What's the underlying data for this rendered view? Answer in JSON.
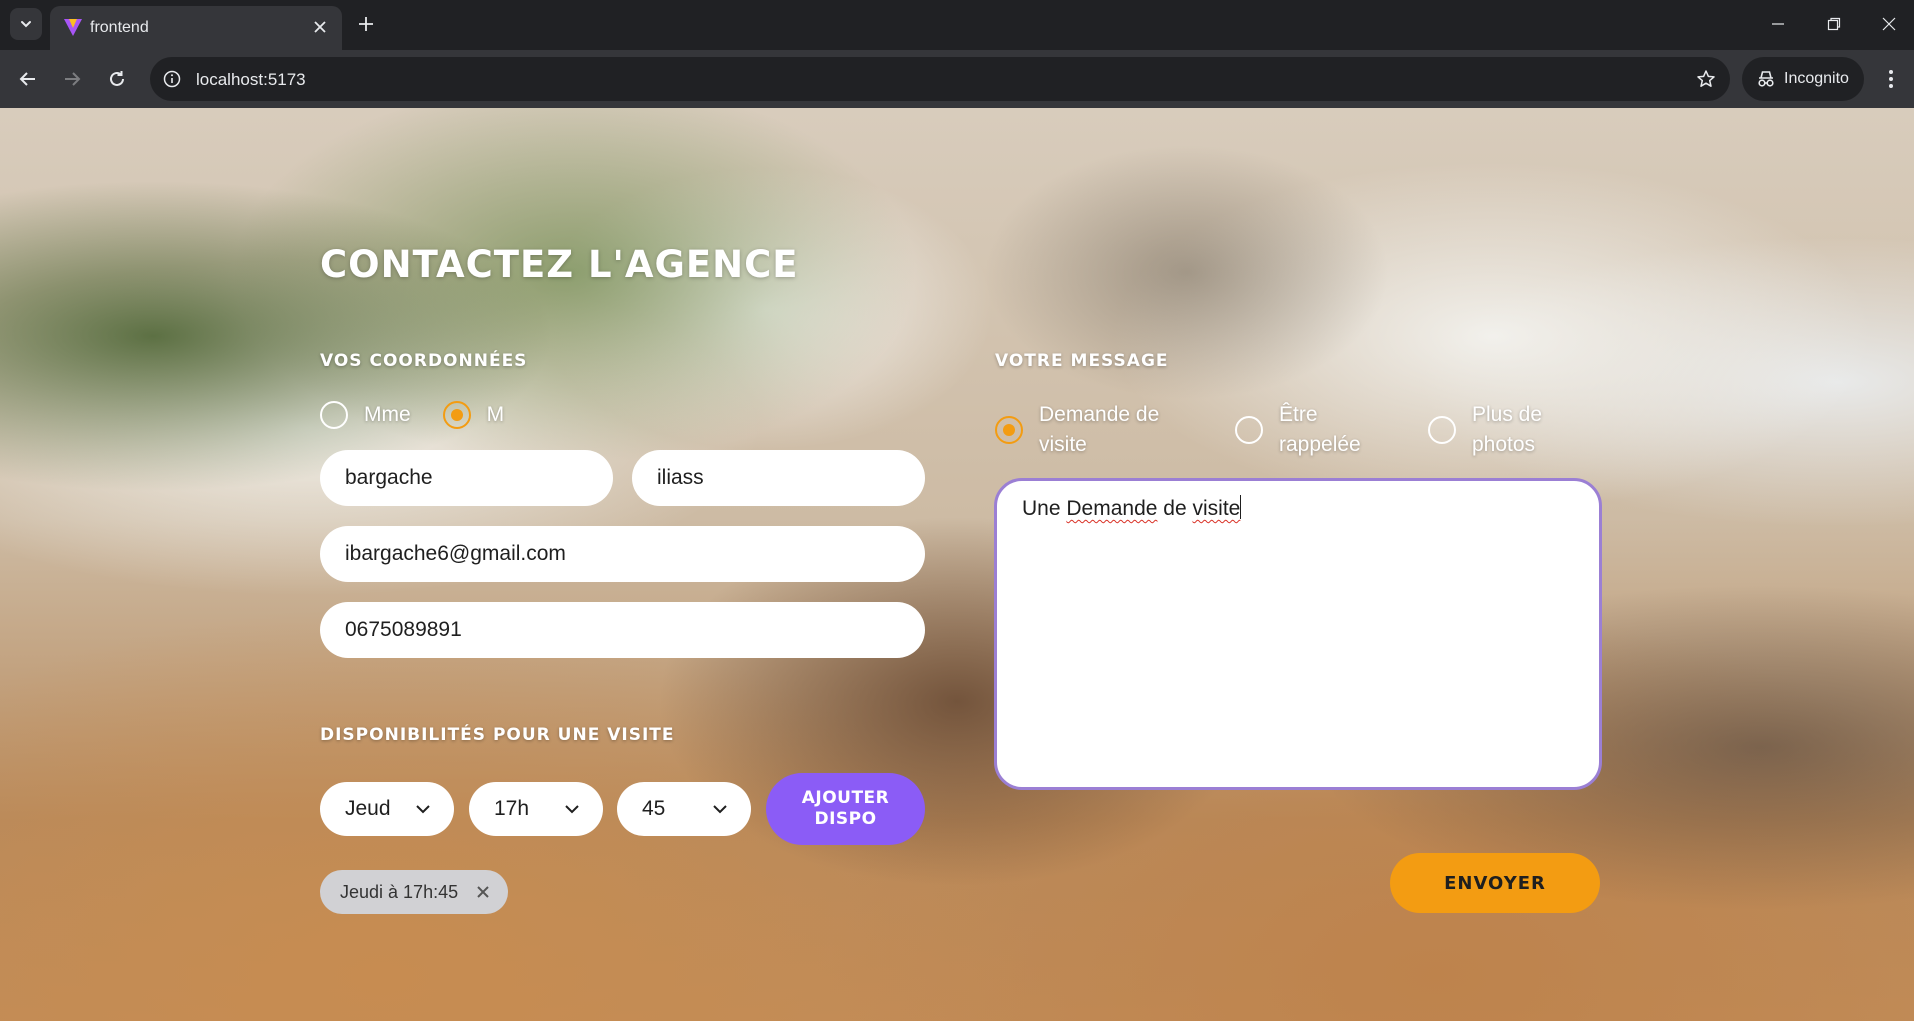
{
  "browser": {
    "tab_title": "frontend",
    "url": "localhost:5173",
    "incognito_label": "Incognito"
  },
  "page": {
    "title": "CONTACTEZ L'AGENCE",
    "coordonnees": {
      "section_label": "VOS COORDONNÉES",
      "civility_options": [
        {
          "label": "Mme",
          "checked": false
        },
        {
          "label": "M",
          "checked": true
        }
      ],
      "nom_value": "bargache",
      "prenom_value": "iliass",
      "email_value": "ibargache6@gmail.com",
      "phone_value": "0675089891"
    },
    "disponibilites": {
      "section_label": "DISPONIBILITÉS POUR UNE VISITE",
      "day_value": "Jeudi",
      "hour_value": "17h",
      "minute_value": "45",
      "add_button_line1": "AJOUTER",
      "add_button_line2": "DISPO",
      "chips": [
        {
          "label": "Jeudi à 17h:45"
        }
      ]
    },
    "message": {
      "section_label": "VOTRE MESSAGE",
      "type_options": [
        {
          "line1": "Demande de",
          "line2": "visite",
          "checked": true
        },
        {
          "line1": "Être",
          "line2": "rappelée",
          "checked": false
        },
        {
          "line1": "Plus de",
          "line2": "photos",
          "checked": false
        }
      ],
      "text_part1": "Une",
      "text_part2": "Demande",
      "text_part3": "de",
      "text_part4": "visite",
      "send_button": "ENVOYER"
    }
  },
  "colors": {
    "accent_orange": "#f39c12",
    "accent_purple": "#8b5cf6",
    "chrome_dark": "#202124",
    "chrome_toolbar": "#35363a"
  }
}
